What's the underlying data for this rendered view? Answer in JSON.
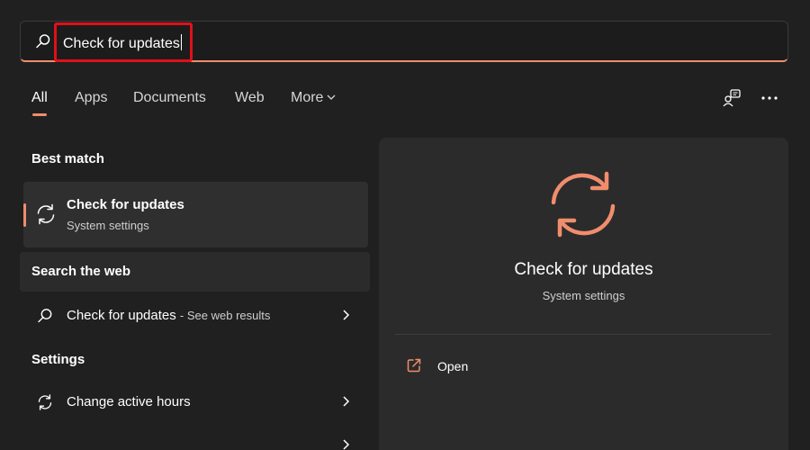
{
  "search": {
    "query": "Check for updates"
  },
  "tabs": [
    {
      "label": "All"
    },
    {
      "label": "Apps"
    },
    {
      "label": "Documents"
    },
    {
      "label": "Web"
    },
    {
      "label": "More"
    }
  ],
  "sections": {
    "best_match": "Best match",
    "search_web": "Search the web",
    "settings": "Settings"
  },
  "best_match": {
    "title": "Check for updates",
    "subtitle": "System settings"
  },
  "web_result": {
    "label": "Check for updates",
    "hint": "- See web results"
  },
  "settings_results": [
    {
      "label": "Change active hours"
    },
    {
      "label": ""
    }
  ],
  "preview": {
    "title": "Check for updates",
    "subtitle": "System settings",
    "open_label": "Open"
  },
  "colors": {
    "accent": "#f08d6c",
    "highlight_box": "#e0101a",
    "background": "#202020",
    "panel": "#2b2b2b"
  },
  "icons": {
    "search": "search-icon",
    "refresh": "refresh-icon",
    "open": "open-external-icon",
    "more_options": "ellipsis-icon",
    "feedback": "feedback-icon",
    "chevron": "chevron-right-icon"
  }
}
